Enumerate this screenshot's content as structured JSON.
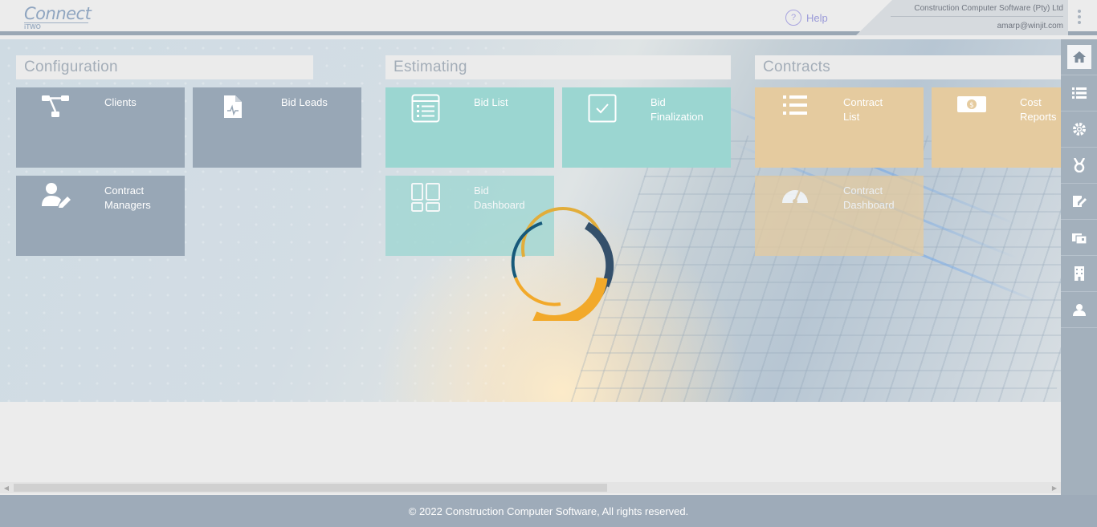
{
  "header": {
    "logo_text": "Connect",
    "logo_sub": "iTWO",
    "help_label": "Help",
    "help_glyph": "?",
    "company": "Construction Computer Software (Pty) Ltd",
    "email": "amarp@winjit.com"
  },
  "colors": {
    "configuration_tile": "#98a7b6",
    "estimating_tile": "#9bd6d1",
    "contracts_tile": "#e5cb9f",
    "footer": "#9eabb9",
    "rail": "#a3b0bc"
  },
  "sections": {
    "configuration": {
      "title": "Configuration",
      "tiles": [
        {
          "label": "Clients",
          "icon": "hierarchy-icon"
        },
        {
          "label": "Bid Leads",
          "icon": "document-icon"
        },
        {
          "label": "Contract\nManagers",
          "icon": "user-edit-icon"
        }
      ]
    },
    "estimating": {
      "title": "Estimating",
      "tiles": [
        {
          "label": "Bid List",
          "icon": "list-doc-icon"
        },
        {
          "label": "Bid\nFinalization",
          "icon": "checkbox-icon"
        },
        {
          "label": "Bid\nDashboard",
          "icon": "dashboard-icon"
        }
      ]
    },
    "contracts": {
      "title": "Contracts",
      "tiles": [
        {
          "label": "Contract\nList",
          "icon": "list-icon"
        },
        {
          "label": "Cost\nReports",
          "icon": "money-icon"
        },
        {
          "label": "Contract\nDashboard",
          "icon": "gauge-icon"
        }
      ]
    }
  },
  "rail": [
    {
      "name": "home-icon"
    },
    {
      "name": "list-icon"
    },
    {
      "name": "settings-icon"
    },
    {
      "name": "medal-icon"
    },
    {
      "name": "edit-doc-icon"
    },
    {
      "name": "cards-icon"
    },
    {
      "name": "building-icon"
    },
    {
      "name": "user-icon"
    }
  ],
  "footer": {
    "text": "© 2022 Construction Computer Software, All rights reserved."
  }
}
